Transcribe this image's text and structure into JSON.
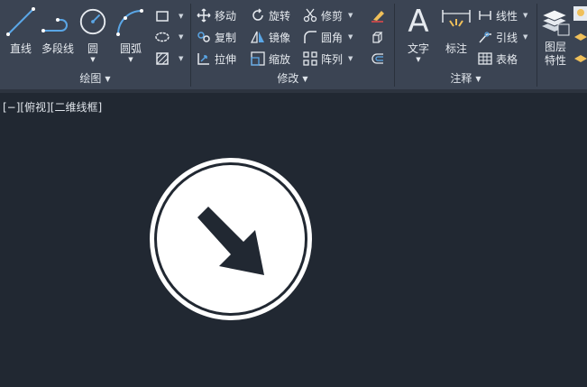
{
  "ribbon": {
    "draw_panel": {
      "title": "绘图",
      "line": "直线",
      "polyline": "多段线",
      "circle": "圆",
      "arc": "圆弧"
    },
    "modify_panel": {
      "title": "修改",
      "move": "移动",
      "rotate": "旋转",
      "trim": "修剪",
      "copy": "复制",
      "mirror": "镜像",
      "fillet": "圆角",
      "stretch": "拉伸",
      "scale": "缩放",
      "array": "阵列"
    },
    "annotation_panel": {
      "title": "注释",
      "text": "文字",
      "dimension": "标注",
      "linear": "线性",
      "leader": "引线",
      "table": "表格"
    },
    "layers_panel": {
      "layer_properties": "图层\n特性"
    }
  },
  "viewport": {
    "label": "[−][俯视][二维线框]"
  },
  "colors": {
    "ribbon_bg": "#3b4453",
    "canvas_bg": "#212832",
    "accent_blue": "#5aa6e6"
  }
}
